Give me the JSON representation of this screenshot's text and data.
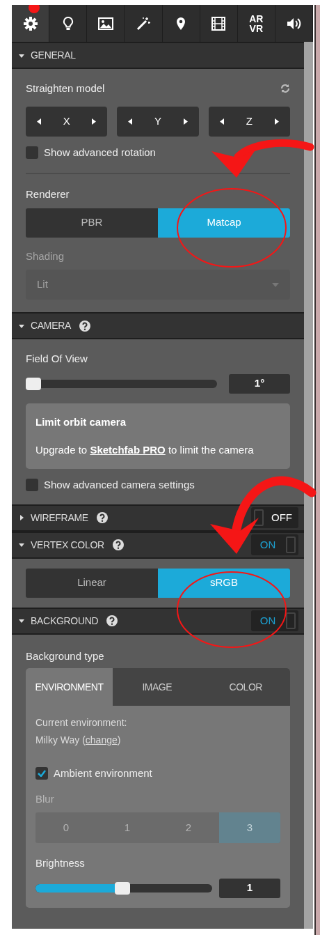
{
  "toolbar_tabs": [
    {
      "selected": true
    },
    {
      "selected": false
    },
    {
      "selected": false
    },
    {
      "selected": false
    },
    {
      "selected": false
    },
    {
      "selected": false
    },
    {
      "selected": false,
      "lines": [
        "AR",
        "VR"
      ]
    },
    {
      "selected": false
    }
  ],
  "general": {
    "title": "GENERAL",
    "expanded": true,
    "straighten_label": "Straighten model",
    "axes": [
      "X",
      "Y",
      "Z"
    ],
    "advanced_rotation": {
      "label": "Show advanced rotation",
      "checked": false
    },
    "renderer": {
      "label": "Renderer",
      "options": [
        {
          "label": "PBR",
          "selected": false
        },
        {
          "label": "Matcap",
          "selected": true
        }
      ]
    },
    "shading": {
      "label": "Shading",
      "value": "Lit",
      "disabled": true
    }
  },
  "camera": {
    "title": "CAMERA",
    "expanded": true,
    "fov": {
      "label": "Field Of View",
      "level": 0.0,
      "value": "1°"
    },
    "upgrade_card": {
      "title": "Limit orbit camera",
      "before": "Upgrade to",
      "link": "Sketchfab PRO",
      "after": "to limit the camera"
    },
    "advanced_camera": {
      "label": "Show advanced camera settings",
      "checked": false
    }
  },
  "wireframe": {
    "title": "WIREFRAME",
    "expanded": false,
    "toggle": {
      "label": "OFF",
      "on": false
    }
  },
  "vertex_color": {
    "title": "VERTEX COLOR",
    "expanded": true,
    "toggle": {
      "label": "ON",
      "on": true
    },
    "options": [
      {
        "label": "Linear",
        "selected": false
      },
      {
        "label": "sRGB",
        "selected": true
      }
    ]
  },
  "background": {
    "title": "BACKGROUND",
    "expanded": true,
    "toggle": {
      "label": "ON",
      "on": true
    },
    "type_label": "Background type",
    "tabs": [
      {
        "label": "ENVIRONMENT",
        "selected": true
      },
      {
        "label": "IMAGE",
        "selected": false
      },
      {
        "label": "COLOR",
        "selected": false
      }
    ],
    "current_label": "Current environment:",
    "env_name": "Milky Way (",
    "change_link": "change",
    "env_suffix": ")",
    "ambient": {
      "label": "Ambient environment",
      "checked": true
    },
    "blur": {
      "label": "Blur",
      "disabled": true,
      "options": [
        {
          "label": "0",
          "selected": false
        },
        {
          "label": "1",
          "selected": false
        },
        {
          "label": "2",
          "selected": false
        },
        {
          "label": "3",
          "selected": true
        }
      ]
    },
    "brightness": {
      "label": "Brightness",
      "level": 0.49,
      "value": "1"
    }
  }
}
